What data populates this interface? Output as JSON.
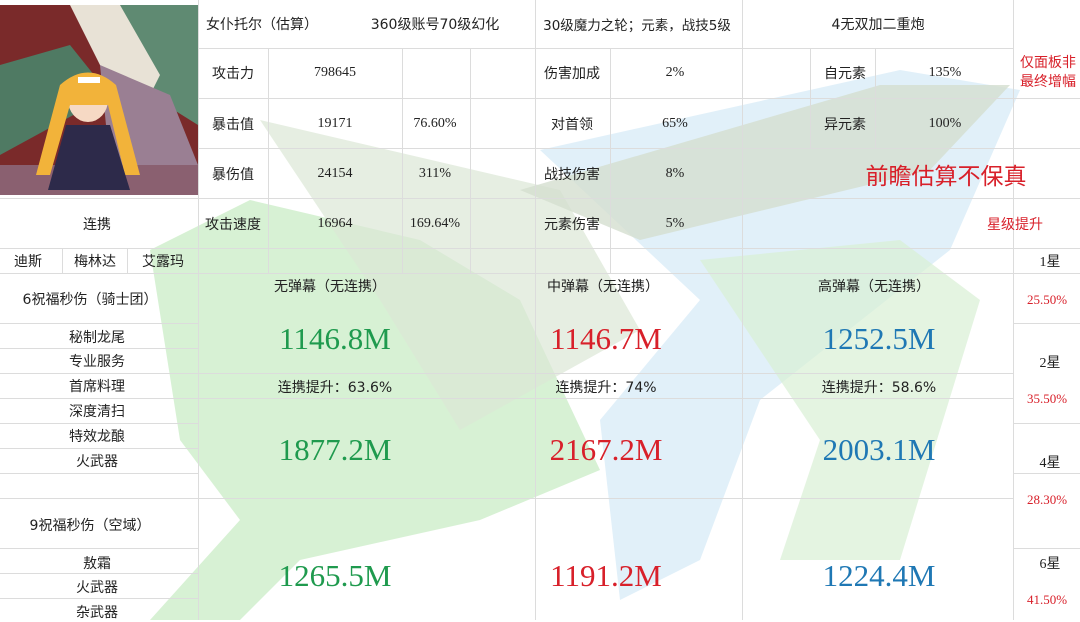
{
  "header": {
    "character": "女仆托尔（估算）",
    "account": "360级账号70级幻化",
    "wheel": "30级魔力之轮；元素，战技5级",
    "weapon": "4无双加二重炮"
  },
  "stats": [
    {
      "label": "攻击力",
      "value": "798645",
      "pct": ""
    },
    {
      "label": "暴击值",
      "value": "19171",
      "pct": "76.60%"
    },
    {
      "label": "暴伤值",
      "value": "24154",
      "pct": "311%"
    },
    {
      "label": "攻击速度",
      "value": "16964",
      "pct": "169.64%"
    }
  ],
  "bonuses": [
    {
      "label": "伤害加成",
      "value": "2%"
    },
    {
      "label": "对首领",
      "value": "65%"
    },
    {
      "label": "战技伤害",
      "value": "8%"
    },
    {
      "label": "元素伤害",
      "value": "5%"
    }
  ],
  "elements": [
    {
      "label": "自元素",
      "value": "135%"
    },
    {
      "label": "异元素",
      "value": "100%"
    }
  ],
  "notes": {
    "panel_note": "仅面板非最终增幅",
    "disclaimer": "前瞻估算不保真",
    "star_title": "星级提升"
  },
  "link": {
    "title": "连携",
    "members": [
      "迪斯",
      "梅林达",
      "艾露玛"
    ]
  },
  "group1": {
    "title": "6祝福秒伤（骑士团）",
    "items": [
      "秘制龙尾",
      "专业服务",
      "首席料理",
      "深度清扫",
      "特效龙酿",
      "火武器"
    ]
  },
  "group2": {
    "title": "9祝福秒伤（空域）",
    "items": [
      "敖霜",
      "火武器",
      "杂武器"
    ]
  },
  "columns": [
    {
      "header": "无弹幕（无连携）",
      "base": "1146.8M",
      "boost": "连携提升：63.6%",
      "linked": "1877.2M",
      "sky": "1265.5M",
      "color": "#1f9a4e"
    },
    {
      "header": "中弹幕（无连携）",
      "base": "1146.7M",
      "boost": "连携提升：74%",
      "linked": "2167.2M",
      "sky": "1191.2M",
      "color": "#d8202a"
    },
    {
      "header": "高弹幕（无连携）",
      "base": "1252.5M",
      "boost": "连携提升：58.6%",
      "linked": "2003.1M",
      "sky": "1224.4M",
      "color": "#1f78b4"
    }
  ],
  "stars": [
    {
      "label": "1星",
      "gain": "25.50%"
    },
    {
      "label": "2星",
      "gain": "35.50%"
    },
    {
      "label": "4星",
      "gain": "28.30%"
    },
    {
      "label": "6星",
      "gain": "41.50%"
    }
  ]
}
